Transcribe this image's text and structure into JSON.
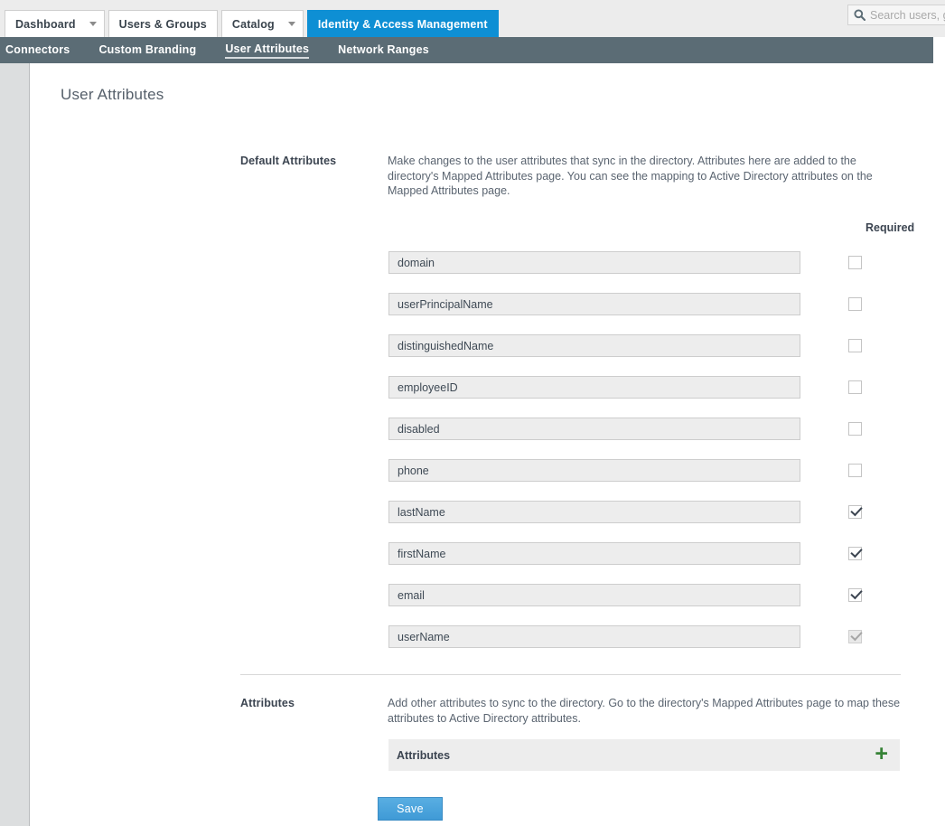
{
  "topnav": {
    "tabs": [
      {
        "label": "Dashboard",
        "has_caret": true,
        "active": false
      },
      {
        "label": "Users & Groups",
        "has_caret": false,
        "active": false
      },
      {
        "label": "Catalog",
        "has_caret": true,
        "active": false
      },
      {
        "label": "Identity & Access Management",
        "has_caret": false,
        "active": true
      }
    ],
    "search": {
      "icon": "search-icon",
      "placeholder": "Search users, g",
      "value": ""
    }
  },
  "subnav": {
    "items": [
      {
        "label": "Connectors",
        "active": false
      },
      {
        "label": "Custom Branding",
        "active": false
      },
      {
        "label": "User Attributes",
        "active": true
      },
      {
        "label": "Network Ranges",
        "active": false
      }
    ]
  },
  "page": {
    "title": "User Attributes"
  },
  "default_attributes": {
    "label": "Default Attributes",
    "description": "Make changes to the user attributes that sync in the directory. Attributes here are added to the directory's Mapped Attributes page.  You can see the mapping to Active Directory attributes on the Mapped Attributes page.",
    "required_header": "Required",
    "rows": [
      {
        "value": "domain",
        "required": false,
        "disabled": false
      },
      {
        "value": "userPrincipalName",
        "required": false,
        "disabled": false
      },
      {
        "value": "distinguishedName",
        "required": false,
        "disabled": false
      },
      {
        "value": "employeeID",
        "required": false,
        "disabled": false
      },
      {
        "value": "disabled",
        "required": false,
        "disabled": false
      },
      {
        "value": "phone",
        "required": false,
        "disabled": false
      },
      {
        "value": "lastName",
        "required": true,
        "disabled": false
      },
      {
        "value": "firstName",
        "required": true,
        "disabled": false
      },
      {
        "value": "email",
        "required": true,
        "disabled": false
      },
      {
        "value": "userName",
        "required": true,
        "disabled": true
      }
    ]
  },
  "custom_attributes": {
    "label": "Attributes",
    "description": "Add other attributes to sync to the directory. Go to the directory's Mapped Attributes page to map these attributes to Active Directory attributes.",
    "bar_label": "Attributes",
    "add_icon": "plus-icon"
  },
  "actions": {
    "save_label": "Save"
  },
  "colors": {
    "accent_blue": "#0e8fd4",
    "subnav_bg": "#5b6c75",
    "save_button": "#4ba3db",
    "add_icon_green": "#368236",
    "field_bg": "#ededed",
    "left_rail": "#dcdedf"
  }
}
